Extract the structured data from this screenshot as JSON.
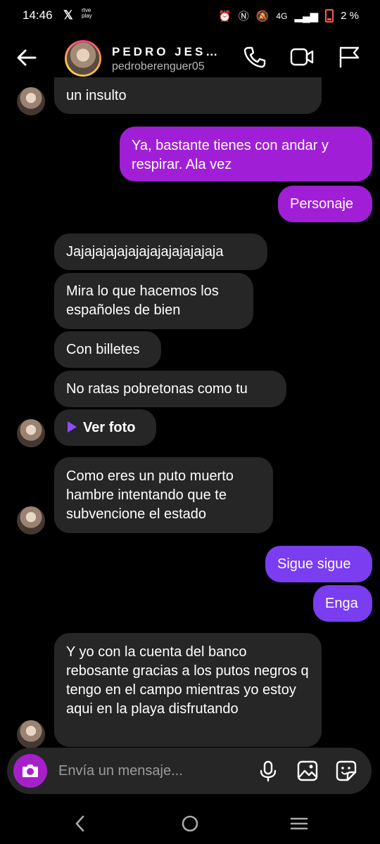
{
  "status_bar": {
    "time": "14:46",
    "x_label": "𝕏",
    "rtve_label": "rtve",
    "rtve_sub": "play",
    "network": "4G",
    "battery_percent": "2 %"
  },
  "header": {
    "name": "PEDRO JES…",
    "username": "pedroberenguer05"
  },
  "messages": [
    {
      "text": "un insulto",
      "side": "in"
    },
    {
      "text": "Ya, bastante tienes con andar y respirar. Ala vez",
      "side": "out"
    },
    {
      "text": "Personaje",
      "side": "out"
    },
    {
      "text": "Jajajajajajajajajajajajajaja",
      "side": "in"
    },
    {
      "text": "Mira lo que hacemos los españoles de bien",
      "side": "in"
    },
    {
      "text": "Con billetes",
      "side": "in"
    },
    {
      "text": "No ratas pobretonas como tu",
      "side": "in"
    },
    {
      "text": "Ver foto",
      "side": "in"
    },
    {
      "text": "Como eres un puto muerto hambre intentando que te subvencione el estado",
      "side": "in"
    },
    {
      "text": "Sigue sigue",
      "side": "out"
    },
    {
      "text": "Enga",
      "side": "out"
    },
    {
      "text": "Y yo con la cuenta del banco rebosante gracias a los putos negros q tengo en el campo mientras yo estoy aqui en la playa disfrutando",
      "side": "in"
    }
  ],
  "composer": {
    "placeholder": "Envía un mensaje..."
  },
  "colors": {
    "incoming_bubble": "#262626",
    "outgoing_purple": "#a01fd6",
    "outgoing_violet": "#7a3df0",
    "camera_button": "#a620c9"
  },
  "icons": [
    "back-arrow-icon",
    "phone-icon",
    "video-icon",
    "flag-icon",
    "camera-icon",
    "microphone-icon",
    "gallery-icon",
    "sticker-icon",
    "play-icon",
    "nav-back-icon",
    "nav-home-icon",
    "nav-menu-icon"
  ]
}
